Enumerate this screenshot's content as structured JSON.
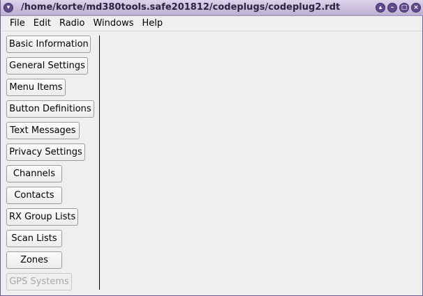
{
  "window": {
    "title": "/home/korte/md380tools.safe201812/codeplugs/codeplug2.rdt",
    "controls": {
      "menu_glyph": "▾",
      "shade_glyph": "▴",
      "minimize_glyph": "–",
      "maximize_glyph": "□",
      "close_glyph": "×"
    }
  },
  "menubar": {
    "items": [
      "File",
      "Edit",
      "Radio",
      "Windows",
      "Help"
    ]
  },
  "sidebar": {
    "buttons": [
      {
        "label": "Basic Information",
        "enabled": true
      },
      {
        "label": "General Settings",
        "enabled": true
      },
      {
        "label": "Menu Items",
        "enabled": true
      },
      {
        "label": "Button Definitions",
        "enabled": true
      },
      {
        "label": "Text Messages",
        "enabled": true
      },
      {
        "label": "Privacy Settings",
        "enabled": true
      },
      {
        "label": "Channels",
        "enabled": true
      },
      {
        "label": "Contacts",
        "enabled": true
      },
      {
        "label": "RX Group Lists",
        "enabled": true
      },
      {
        "label": "Scan Lists",
        "enabled": true
      },
      {
        "label": "Zones",
        "enabled": true
      },
      {
        "label": "GPS Systems",
        "enabled": false
      }
    ]
  },
  "colors": {
    "titlebar": "#cbbfdd",
    "title_button": "#5f4c8c",
    "background": "#efefef",
    "disabled_text": "#a8a8a8"
  }
}
